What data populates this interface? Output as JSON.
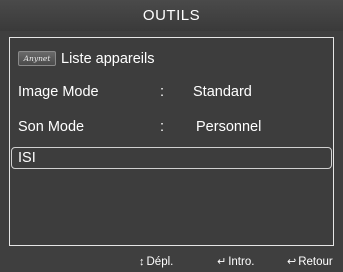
{
  "title": "OUTILS",
  "menu": {
    "items": [
      {
        "icon": "anynet-logo",
        "logo_text": "Anynet",
        "label": "Liste appareils",
        "sep": "",
        "value": ""
      },
      {
        "label": "Image Mode",
        "sep": ":",
        "value": "Standard"
      },
      {
        "label": "Son Mode",
        "sep": ":",
        "value": "Personnel"
      },
      {
        "label": "ISI",
        "sep": "",
        "value": "",
        "selected": true
      }
    ]
  },
  "footer": {
    "move": {
      "icon": "updown-arrows-icon",
      "glyph": "↕",
      "label": "Dépl."
    },
    "enter": {
      "icon": "enter-icon",
      "glyph": "↵",
      "label": "Intro."
    },
    "back": {
      "icon": "return-icon",
      "glyph": "↩",
      "label": "Retour"
    }
  },
  "colors": {
    "background": "#3f3f3f",
    "text": "#ffffff",
    "border": "#e6e6e6"
  }
}
